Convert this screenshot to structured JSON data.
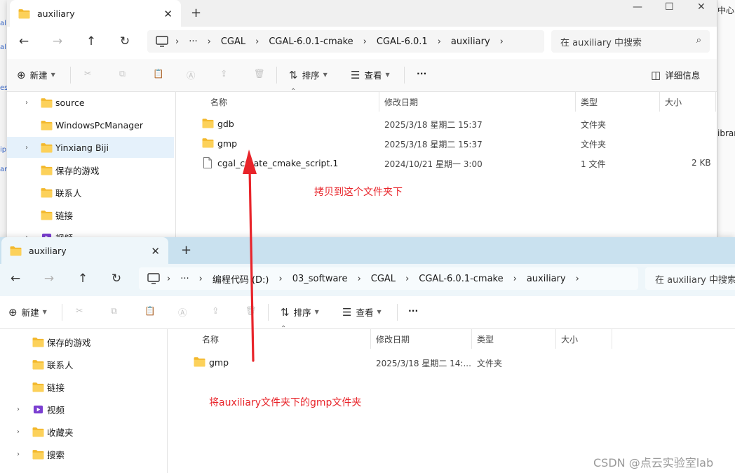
{
  "background": {
    "left_fragments": [
      "al",
      "al",
      "es",
      "ip",
      "ar"
    ],
    "right_fragments": [
      "中心",
      "ibrar"
    ]
  },
  "window_top": {
    "tab_title": "auxiliary",
    "new_tab": "+",
    "close_tab": "✕",
    "controls": [
      "—",
      "☐",
      "✕"
    ],
    "breadcrumb": [
      "CGAL",
      "CGAL-6.0.1-cmake",
      "CGAL-6.0.1",
      "auxiliary"
    ],
    "ellipsis": "···",
    "search_placeholder": "在 auxiliary 中搜索",
    "commands": {
      "new": "新建",
      "sort": "排序",
      "view": "查看",
      "more": "···",
      "details": "详细信息"
    },
    "nav_items": [
      "source",
      "WindowsPcManager",
      "Yinxiang Biji",
      "保存的游戏",
      "联系人",
      "链接",
      "视频"
    ],
    "columns": {
      "name": "名称",
      "modified": "修改日期",
      "type": "类型",
      "size": "大小"
    },
    "rows": [
      {
        "name": "gdb",
        "modified": "2025/3/18 星期二 15:37",
        "type": "文件夹",
        "size": ""
      },
      {
        "name": "gmp",
        "modified": "2025/3/18 星期二 15:37",
        "type": "文件夹",
        "size": ""
      },
      {
        "name": "cgal_create_cmake_script.1",
        "modified": "2024/10/21 星期一 3:00",
        "type": "1 文件",
        "size": "2 KB"
      }
    ]
  },
  "window_bottom": {
    "tab_title": "auxiliary",
    "new_tab": "+",
    "close_tab": "✕",
    "breadcrumb": [
      "编程代码 (D:)",
      "03_software",
      "CGAL",
      "CGAL-6.0.1-cmake",
      "auxiliary"
    ],
    "ellipsis": "···",
    "search_placeholder": "在 auxiliary 中搜索",
    "commands": {
      "new": "新建",
      "sort": "排序",
      "view": "查看",
      "more": "···"
    },
    "nav_items": [
      "保存的游戏",
      "联系人",
      "链接",
      "视频",
      "收藏夹",
      "搜索"
    ],
    "columns": {
      "name": "名称",
      "modified": "修改日期",
      "type": "类型",
      "size": "大小"
    },
    "rows": [
      {
        "name": "gmp",
        "modified": "2025/3/18 星期二 14:...",
        "type": "文件夹",
        "size": ""
      }
    ]
  },
  "annotations": {
    "copy_here": "拷贝到这个文件夹下",
    "source_note": "将auxiliary文件夹下的gmp文件夹",
    "accent_color": "#e8242a"
  },
  "watermark": "CSDN @点云实验室lab"
}
